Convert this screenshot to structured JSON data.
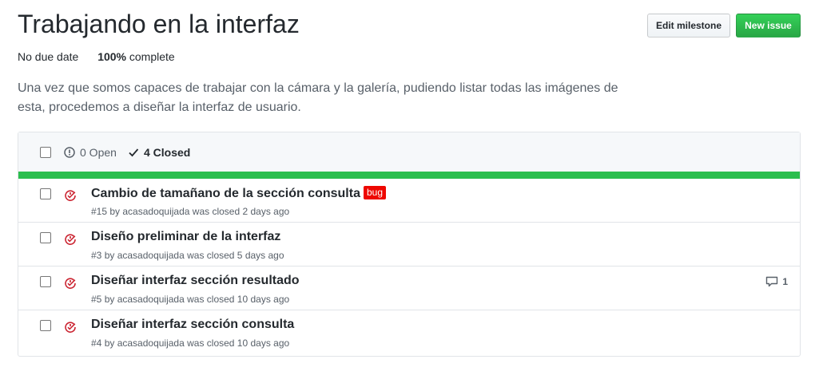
{
  "milestone": {
    "title": "Trabajando en la interfaz",
    "edit_label": "Edit milestone",
    "new_issue_label": "New issue",
    "due": "No due date",
    "percent": "100%",
    "complete_label": "complete",
    "description": "Una vez que somos capaces de trabajar con la cámara y la galería, pudiendo listar todas las imágenes de esta, procedemos a diseñar la interfaz de usuario.",
    "progress": 1.0,
    "progress_color": "#2cbe4e"
  },
  "filter": {
    "open_label": "0 Open",
    "closed_label": "4 Closed"
  },
  "issues": [
    {
      "title": "Cambio de tamañano de la sección consulta",
      "label": "bug",
      "label_color": "#ee0701",
      "number": "#15",
      "byline": "by acasadoquijada was closed 2 days ago",
      "comments": ""
    },
    {
      "title": "Diseño preliminar de la interfaz",
      "label": "",
      "number": "#3",
      "byline": "by acasadoquijada was closed 5 days ago",
      "comments": ""
    },
    {
      "title": "Diseñar interfaz sección resultado",
      "label": "",
      "number": "#5",
      "byline": "by acasadoquijada was closed 10 days ago",
      "comments": "1"
    },
    {
      "title": "Diseñar interfaz sección consulta",
      "label": "",
      "number": "#4",
      "byline": "by acasadoquijada was closed 10 days ago",
      "comments": ""
    }
  ],
  "icons": {
    "closed_issue": "issue-closed-icon",
    "open_issue": "issue-opened-icon",
    "check": "check-icon",
    "comment": "comment-icon"
  },
  "colors": {
    "closed_icon": "#cb2431",
    "new_issue_button": "#28a745"
  }
}
